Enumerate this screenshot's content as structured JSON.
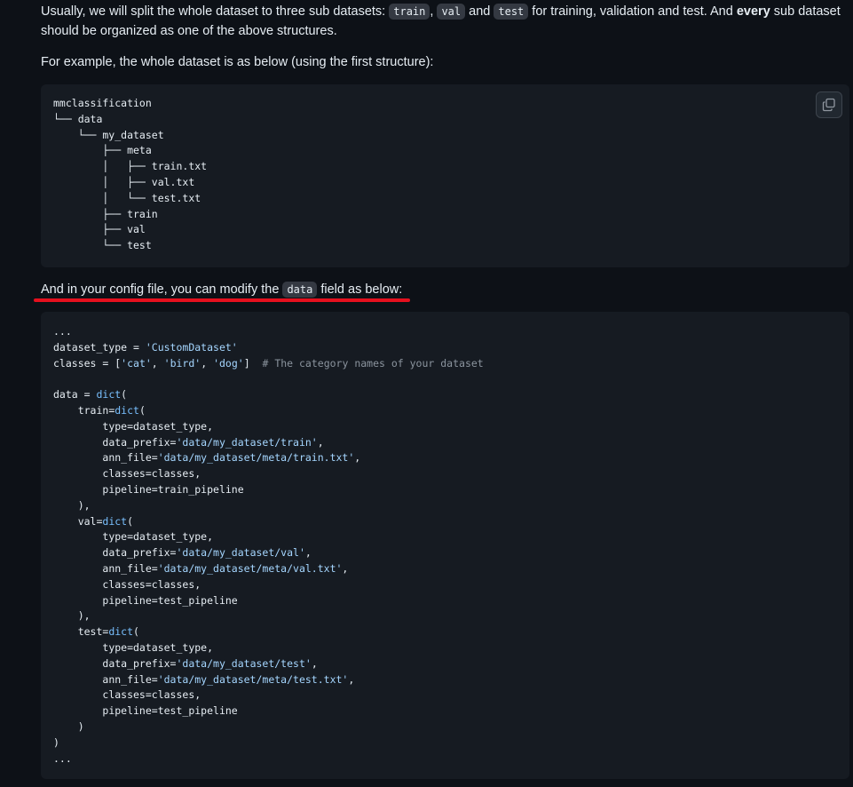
{
  "intro": {
    "text_before": "Usually, we will split the whole dataset to three sub datasets: ",
    "code_train": "train",
    "comma": ", ",
    "code_val": "val",
    "and": " and ",
    "code_test": "test",
    "text_after": " for training, validation and test. And ",
    "bold_every": "every",
    "text_end": " sub dataset should be organized as one of the above structures."
  },
  "example_text": "For example, the whole dataset is as below (using the first structure):",
  "tree_block": {
    "lines": [
      "mmclassification",
      "└── data",
      "    └── my_dataset",
      "        ├── meta",
      "        │   ├── train.txt",
      "        │   ├── val.txt",
      "        │   └── test.txt",
      "        ├── train",
      "        ├── val",
      "        └── test"
    ]
  },
  "config_text": {
    "before": "And in your config file, you can modify the ",
    "code": "data",
    "after": " field as below:"
  },
  "config_block": {
    "ellipsis_top": "...",
    "dataset_type_line": {
      "lhs": "dataset_type = ",
      "value": "'CustomDataset'"
    },
    "classes_line": {
      "lhs": "classes = [",
      "c1": "'cat'",
      "c2": "'bird'",
      "c3": "'dog'",
      "rhs": "]  ",
      "comment": "# The category names of your dataset"
    },
    "data_line": {
      "lhs": "data = ",
      "fn": "dict",
      "rhs": "("
    },
    "train": {
      "head": "train=",
      "type": "type=dataset_type,",
      "prefix_key": "data_prefix=",
      "prefix": "'data/my_dataset/train'",
      "ann_key": "ann_file=",
      "ann": "'data/my_dataset/meta/train.txt'",
      "classes": "classes=classes,",
      "pipeline": "pipeline=train_pipeline"
    },
    "val": {
      "head": "val=",
      "type": "type=dataset_type,",
      "prefix_key": "data_prefix=",
      "prefix": "'data/my_dataset/val'",
      "ann_key": "ann_file=",
      "ann": "'data/my_dataset/meta/val.txt'",
      "classes": "classes=classes,",
      "pipeline": "pipeline=test_pipeline"
    },
    "test": {
      "head": "test=",
      "type": "type=dataset_type,",
      "prefix_key": "data_prefix=",
      "prefix": "'data/my_dataset/test'",
      "ann_key": "ann_file=",
      "ann": "'data/my_dataset/meta/test.txt'",
      "classes": "classes=classes,",
      "pipeline": "pipeline=test_pipeline"
    },
    "close_inner": "),",
    "close_last": ")",
    "close_outer": ")",
    "ellipsis_bottom": "..."
  },
  "icons": {
    "copy": "copy-icon"
  },
  "colors": {
    "background": "#0d1117",
    "code_bg": "#161b22",
    "highlight_underline": "#e5101e",
    "string": "#a5d6ff",
    "comment": "#8b949e"
  }
}
